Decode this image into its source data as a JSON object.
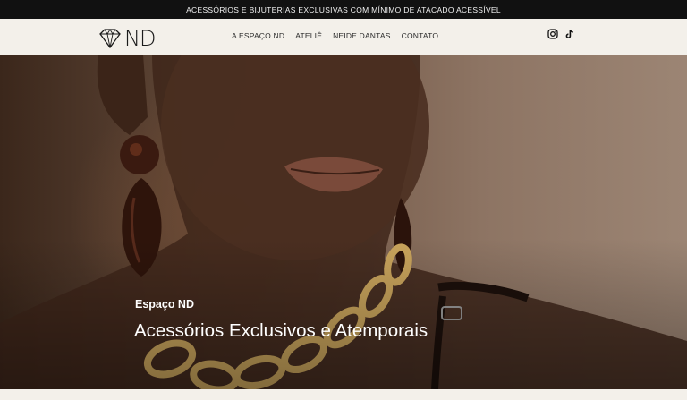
{
  "announcement": {
    "text": "ACESSÓRIOS E BIJUTERIAS EXCLUSIVAS COM MÍNIMO DE ATACADO ACESSÍVEL"
  },
  "header": {
    "logo_text": "ND",
    "nav": [
      {
        "label": "A ESPAÇO ND"
      },
      {
        "label": "ATELIÊ"
      },
      {
        "label": "NEIDE DANTAS"
      },
      {
        "label": "CONTATO"
      }
    ],
    "social": [
      {
        "icon": "instagram-icon"
      },
      {
        "icon": "tiktok-icon"
      }
    ]
  },
  "hero": {
    "subtitle": "Espaço ND",
    "title": "Acessórios Exclusivos e Atemporais"
  },
  "colors": {
    "topbar": "#111111",
    "header_bg": "#f3f0ea",
    "hero_bg": "#7a5e4b",
    "text_light": "#ffffff"
  }
}
